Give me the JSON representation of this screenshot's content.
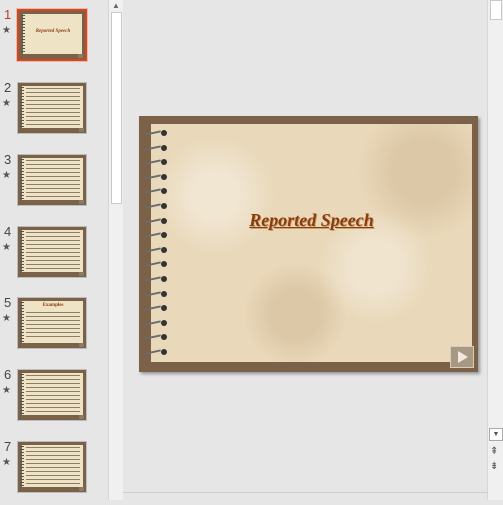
{
  "slides": [
    {
      "number": "1",
      "title": "Reported Speech",
      "active": true
    },
    {
      "number": "2",
      "title": ""
    },
    {
      "number": "3",
      "title": ""
    },
    {
      "number": "4",
      "title": ""
    },
    {
      "number": "5",
      "title": "Examples"
    },
    {
      "number": "6",
      "title": ""
    },
    {
      "number": "7",
      "title": ""
    }
  ],
  "transition_icon": "star-icon",
  "main_slide": {
    "title": "Reported Speech"
  },
  "colors": {
    "accent": "#d24726",
    "slide_frame": "#7b6148",
    "paper": "#e9d8b9",
    "title": "#8c3a10"
  }
}
